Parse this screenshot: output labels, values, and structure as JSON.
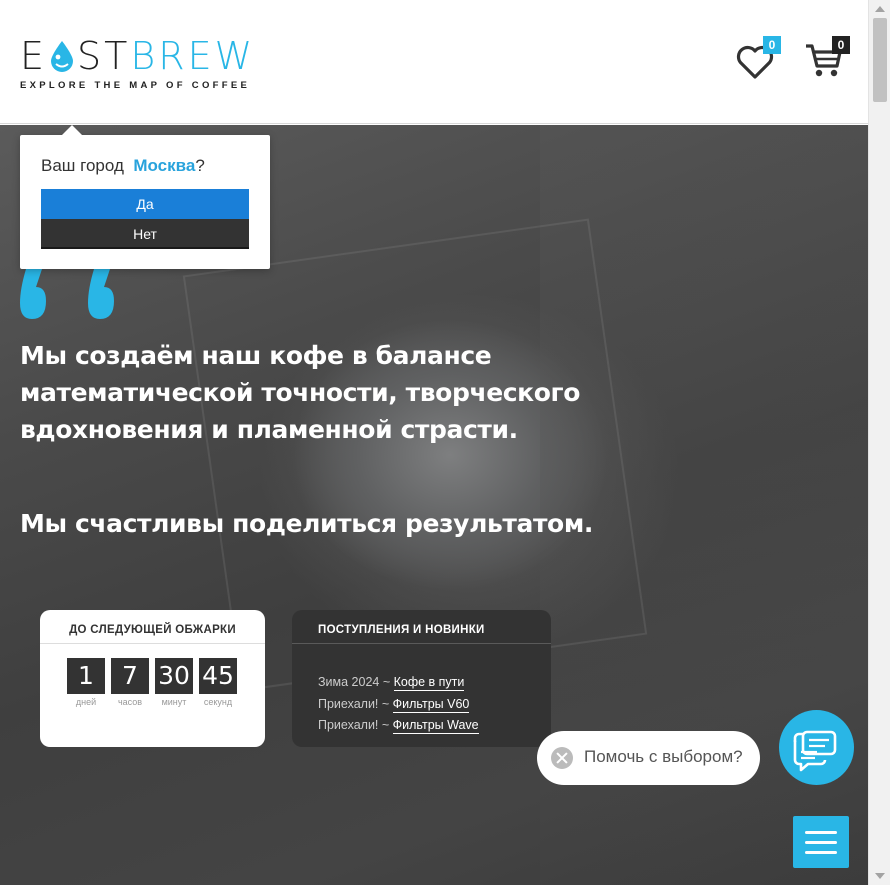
{
  "header": {
    "logo_letter_e": "E",
    "logo_dark": "ST",
    "logo_blue": "BREW",
    "logo_tagline": "EXPLORE THE MAP OF COFFEE",
    "favorites_count": "0",
    "cart_count": "0",
    "accent_color": "#29b6e6"
  },
  "city_popup": {
    "question": "Ваш город",
    "city": "Москва",
    "question_mark": "?",
    "yes_label": "Да",
    "no_label": "Нет"
  },
  "hero": {
    "text_main": "Мы создаём наш кофе в балансе математической точности, творческого вдохновения и пламенной страсти.",
    "text_secondary": "Мы счастливы поделиться результатом."
  },
  "countdown": {
    "title": "ДО СЛЕДУЮЩЕЙ ОБЖАРКИ",
    "units": [
      {
        "value": "1",
        "label": "дней"
      },
      {
        "value": "7",
        "label": "часов"
      },
      {
        "value": "30",
        "label": "минут"
      },
      {
        "value": "45",
        "label": "секунд"
      }
    ]
  },
  "news": {
    "title": "ПОСТУПЛЕНИЯ И НОВИНКИ",
    "items": [
      {
        "prefix": "Зима 2024 ~ ",
        "link": "Кофе в пути"
      },
      {
        "prefix": "Приехали! ~ ",
        "link": "Фильтры V60"
      },
      {
        "prefix": "Приехали! ~ ",
        "link": "Фильтры Wave"
      }
    ]
  },
  "help": {
    "text": "Помочь с выбором?"
  }
}
